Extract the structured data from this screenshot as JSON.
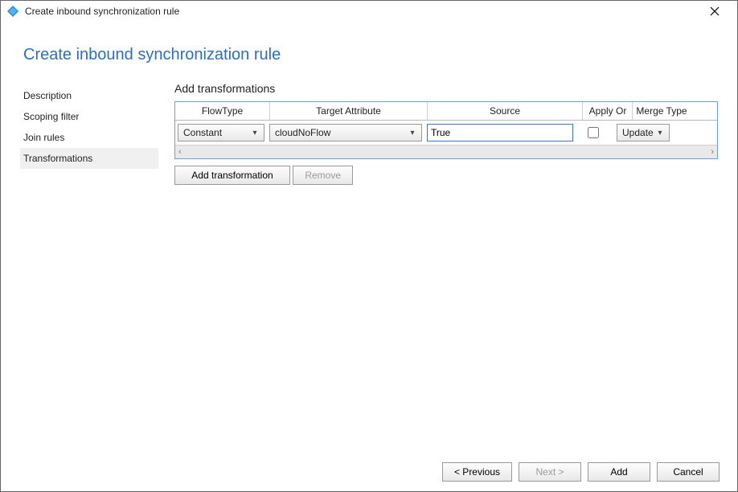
{
  "window": {
    "title": "Create inbound synchronization rule"
  },
  "page": {
    "heading": "Create inbound synchronization rule"
  },
  "sidebar": {
    "items": [
      {
        "label": "Description"
      },
      {
        "label": "Scoping filter"
      },
      {
        "label": "Join rules"
      },
      {
        "label": "Transformations"
      }
    ],
    "active_index": 3
  },
  "main": {
    "section_title": "Add transformations",
    "columns": {
      "flowtype": "FlowType",
      "target": "Target Attribute",
      "source": "Source",
      "applyonce": "Apply Once",
      "merge": "Merge Type"
    },
    "rows": [
      {
        "flowtype": "Constant",
        "target": "cloudNoFlow",
        "source": "True",
        "apply_once": false,
        "merge": "Update"
      }
    ],
    "actions": {
      "add_transformation": "Add transformation",
      "remove": "Remove"
    }
  },
  "footer": {
    "previous": "< Previous",
    "next": "Next >",
    "add": "Add",
    "cancel": "Cancel"
  }
}
